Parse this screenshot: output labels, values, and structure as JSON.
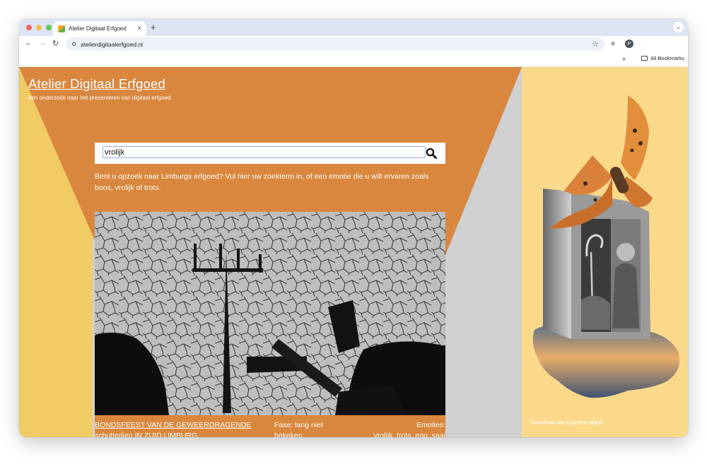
{
  "browser": {
    "tab_title": "Atelier Digitaal Erfgoed",
    "tab_close": "×",
    "new_tab": "+",
    "address": "atelierdigitaalerfgoed.nl",
    "profile_initial": "P",
    "bookmarks_overflow": "»",
    "all_bookmarks": "All Bookmarks"
  },
  "site": {
    "title": "Atelier Digitaal Erfgoed",
    "subtitle": "een onderzoek naar het presenteren van digitaal erfgoed"
  },
  "search": {
    "value": "vrolijk"
  },
  "intro": "Bent u opzoek naar Limburgs erfgoed? Vul hier uw zoekterm in, of een emotie die u wilt ervaren zoals boos, vrolijk of trots.",
  "result": {
    "title_line1": "BONDSFEEST VAN DE GEWEERDRAGENDE",
    "title_line2": "schutterijen IN ZUID LIMBURG",
    "phase_line1": "Fase: lang niet",
    "phase_line2": "bekeken",
    "emotions_line1": "Emoties:",
    "emotions_line2": "vrolijk, trots, eng, saai"
  },
  "sidebar": {
    "download_label": "Download uw erfgoedcollage"
  },
  "colors": {
    "orange": "#d9873e",
    "yellow": "#f1cb63",
    "grey": "#cfd0d2",
    "panel": "#fad98b"
  }
}
